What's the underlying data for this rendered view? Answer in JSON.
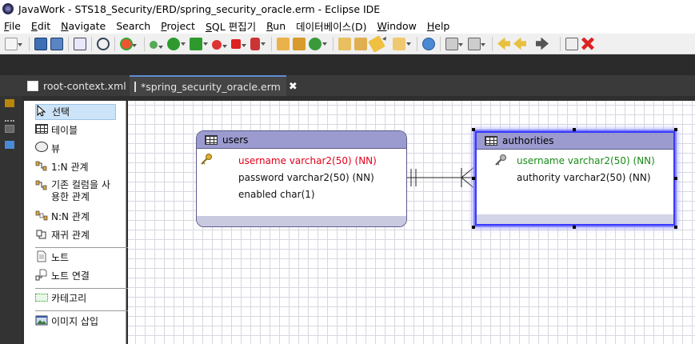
{
  "window": {
    "title": "JavaWork - STS18_Security/ERD/spring_security_oracle.erm - Eclipse IDE"
  },
  "menu": [
    {
      "label": "File",
      "mn": "F",
      "rest": "ile"
    },
    {
      "label": "Edit",
      "mn": "E",
      "rest": "dit"
    },
    {
      "label": "Navigate",
      "mn": "N",
      "rest": "avigate"
    },
    {
      "label": "Search",
      "mn": "",
      "rest": "Search"
    },
    {
      "label": "Project",
      "mn": "P",
      "rest": "roject"
    },
    {
      "label": "SQL 편집기",
      "mn": "S",
      "rest": "QL 편집기"
    },
    {
      "label": "Run",
      "mn": "R",
      "rest": "un"
    },
    {
      "label": "데이터베이스(D)",
      "mn": "",
      "rest": "데이터베이스(D)"
    },
    {
      "label": "Window",
      "mn": "W",
      "rest": "indow"
    },
    {
      "label": "Help",
      "mn": "H",
      "rest": "elp"
    }
  ],
  "tabs": [
    {
      "label": "root-context.xml",
      "icon": "xml-file-icon"
    },
    {
      "label": "*spring_security_oracle.erm",
      "icon": "erd-file-icon",
      "close": "✖"
    }
  ],
  "palette": {
    "items": [
      {
        "label": "선택",
        "icon": "cursor-arrow-icon"
      },
      {
        "label": "테이블",
        "icon": "table-icon"
      },
      {
        "label": "뷰",
        "icon": "view-icon"
      },
      {
        "label": "1:N 관계",
        "icon": "one-to-many-icon"
      },
      {
        "label": "기존 컬럼을 사",
        "label2": "용한 관계",
        "icon": "existing-column-relation-icon"
      },
      {
        "label": "N:N 관계",
        "icon": "many-to-many-icon"
      },
      {
        "label": "재귀 관계",
        "icon": "recursive-relation-icon"
      },
      {
        "label": "노트",
        "icon": "note-icon"
      },
      {
        "label": "노트 연결",
        "icon": "note-connection-icon"
      },
      {
        "label": "카테고리",
        "icon": "category-icon"
      },
      {
        "label": "이미지 삽입",
        "icon": "insert-image-icon"
      }
    ]
  },
  "erd": {
    "users": {
      "name": "users",
      "columns": [
        {
          "text": "username varchar2(50) (NN)",
          "pk": true
        },
        {
          "text": "password varchar2(50) (NN)",
          "pk": false
        },
        {
          "text": "enabled char(1)",
          "pk": false
        }
      ]
    },
    "authorities": {
      "name": "authorities",
      "columns": [
        {
          "text": "username varchar2(50) (NN)",
          "fk": true
        },
        {
          "text": "authority varchar2(50) (NN)",
          "fk": false
        }
      ]
    }
  },
  "colors": {
    "table_header": "#9b9bd0",
    "pk_text": "#e0001a",
    "fk_text": "#1a8a1a",
    "selection": "#3838ff",
    "tab_accent": "#5f8dd3"
  }
}
